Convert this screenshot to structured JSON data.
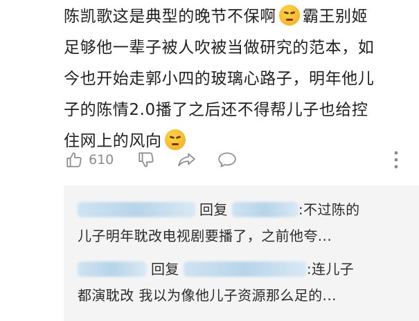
{
  "comment": {
    "lines": [
      {
        "before": "陈凯歌这是典型的晚节不保啊",
        "emoji": "angry-face-emoji",
        "after": "霸王别姬"
      },
      {
        "before": "足够他一辈子被人吹被当做研究的范本，如",
        "emoji": null,
        "after": ""
      },
      {
        "before": "今也开始走郭小四的玻璃心路子，明年他儿",
        "emoji": null,
        "after": ""
      },
      {
        "before": "子的陈情2.0播了之后还不得帮儿子也给控",
        "emoji": null,
        "after": ""
      },
      {
        "before": "住网上的风向",
        "emoji": "smug-face-emoji",
        "after": ""
      }
    ]
  },
  "actions": {
    "like_count": "610",
    "icons": [
      "thumbs-up-icon",
      "thumbs-down-icon",
      "share-icon",
      "comment-icon",
      "more-icon"
    ]
  },
  "replies": [
    {
      "verb": "回复",
      "line1_tail": ":不过陈的",
      "line2": "儿子明年耽改电视剧要播了，之前他夸..."
    },
    {
      "verb": "回复",
      "line1_tail": ":连儿子",
      "line2": "都演耽改 我以为像他儿子资源那么足的..."
    }
  ],
  "colors": {
    "text": "#1f1f1f",
    "muted": "#8a8a8a",
    "reply_bg": "#f4f4f4",
    "redacted_name": "#b7d4ea"
  }
}
